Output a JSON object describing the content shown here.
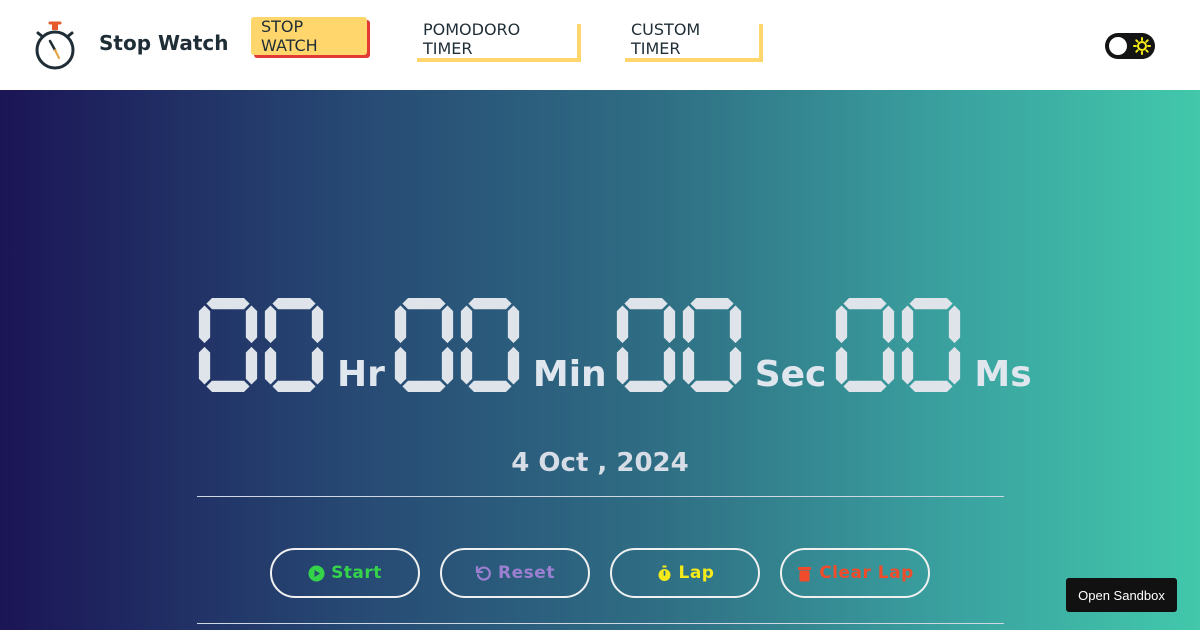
{
  "header": {
    "brand": "Stop Watch",
    "logo_icon": "stopwatch-icon",
    "nav": [
      {
        "label": "STOP WATCH",
        "active": true
      },
      {
        "label": "POMODORO TIMER",
        "active": false
      },
      {
        "label": "CUSTOM TIMER",
        "active": false
      }
    ],
    "theme_toggle": {
      "state": "light",
      "icon": "sun-icon"
    }
  },
  "timer": {
    "hours": "00",
    "hours_unit": "Hr",
    "minutes": "00",
    "minutes_unit": "Min",
    "seconds": "00",
    "seconds_unit": "Sec",
    "millis": "00",
    "millis_unit": "Ms"
  },
  "date": "4 Oct , 2024",
  "controls": {
    "start": "Start",
    "reset": "Reset",
    "lap": "Lap",
    "clear_lap": "Clear Lap"
  },
  "sandbox_button": "Open Sandbox",
  "colors": {
    "start": "#34d34a",
    "reset": "#9b7fd0",
    "lap": "#f4ea1a",
    "clear": "#f04b2a",
    "accent": "#ffd66b"
  }
}
